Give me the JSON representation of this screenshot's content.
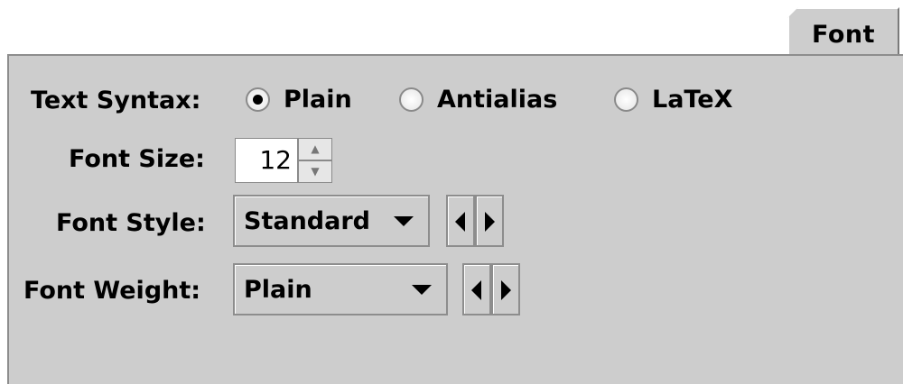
{
  "tab": {
    "label": "Font"
  },
  "form": {
    "text_syntax": {
      "label": "Text Syntax:",
      "options": [
        "Plain",
        "Antialias",
        "LaTeX"
      ],
      "selected": "Plain"
    },
    "font_size": {
      "label": "Font Size:",
      "value": "12"
    },
    "font_style": {
      "label": "Font Style:",
      "value": "Standard"
    },
    "font_weight": {
      "label": "Font Weight:",
      "value": "Plain"
    }
  },
  "icons": {
    "spinner_up": "triangle-up-icon",
    "spinner_down": "triangle-down-icon",
    "combo": "chevron-down-icon",
    "previous": "arrow-left-icon",
    "next": "arrow-right-icon"
  }
}
